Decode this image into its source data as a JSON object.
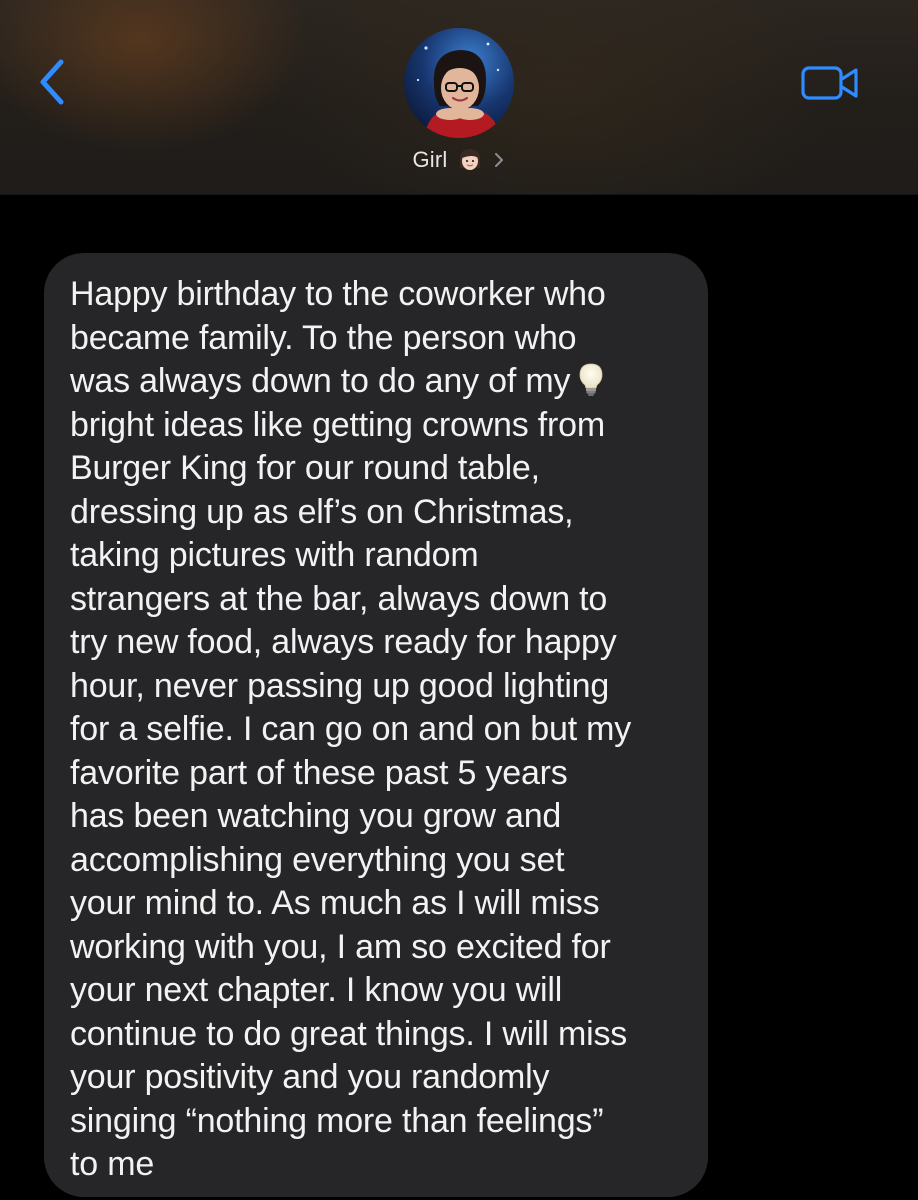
{
  "header": {
    "back_icon": "chevron-left-icon",
    "video_icon": "video-camera-icon",
    "contact": {
      "name": "Girl",
      "name_emoji": "woman-emoji-icon",
      "avatar": "contact-photo",
      "chevron_icon": "chevron-right-icon"
    }
  },
  "message": {
    "lines": [
      "Happy birthday to the coworker who",
      "became family. To the person who",
      "was always down to do any of my",
      "bright ideas like getting crowns from",
      "Burger King for our round table,",
      "dressing up as elf’s on Christmas,",
      "taking pictures with random",
      "strangers at the bar, always down to",
      "try new food, always ready for happy",
      "hour, never passing up good lighting",
      "for a selfie. I can go on and on but my",
      "favorite part of these past 5 years",
      "has been watching you grow and",
      "accomplishing everything you set",
      "your mind to. As much as I will miss",
      "working with you, I am so excited for",
      "your next chapter. I know you will",
      "continue to do great things. I will miss",
      "your positivity and you randomly",
      "singing “nothing more than feelings”",
      "to me"
    ],
    "inline_emoji": "light-bulb-emoji-icon"
  },
  "colors": {
    "accent": "#2f8cff",
    "bubble": "#262628",
    "background": "#000000",
    "text": "#f2f2f2"
  }
}
